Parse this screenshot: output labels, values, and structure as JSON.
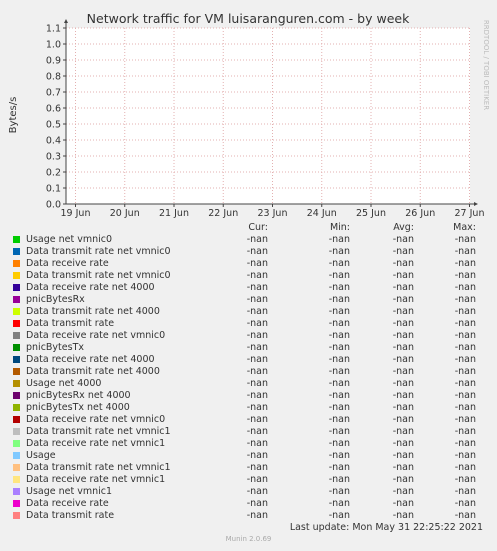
{
  "chart_data": {
    "type": "line",
    "title": "Network traffic for VM luisaranguren.com - by week",
    "ylabel": "Bytes/s",
    "xlabel": "",
    "ylim": [
      0.0,
      1.1
    ],
    "yticks": [
      "0.0",
      "0.1",
      "0.2",
      "0.3",
      "0.4",
      "0.5",
      "0.6",
      "0.7",
      "0.8",
      "0.9",
      "1.0",
      "1.1"
    ],
    "xticks": [
      "19 Jun",
      "20 Jun",
      "21 Jun",
      "22 Jun",
      "23 Jun",
      "24 Jun",
      "25 Jun",
      "26 Jun",
      "27 Jun"
    ],
    "grid": true,
    "watermark": "RRDTOOL / TOBI OETIKER",
    "series": []
  },
  "legend": {
    "headers": [
      "Cur:",
      "Min:",
      "Avg:",
      "Max:"
    ],
    "rows": [
      {
        "name": "Usage net vmnic0",
        "color": "#00cc00",
        "cur": "-nan",
        "min": "-nan",
        "avg": "-nan",
        "max": "-nan"
      },
      {
        "name": "Data transmit rate net vmnic0",
        "color": "#0066b3",
        "cur": "-nan",
        "min": "-nan",
        "avg": "-nan",
        "max": "-nan"
      },
      {
        "name": "Data receive rate",
        "color": "#ff8000",
        "cur": "-nan",
        "min": "-nan",
        "avg": "-nan",
        "max": "-nan"
      },
      {
        "name": "Data transmit rate net vmnic0",
        "color": "#ffcc00",
        "cur": "-nan",
        "min": "-nan",
        "avg": "-nan",
        "max": "-nan"
      },
      {
        "name": "Data receive rate net 4000",
        "color": "#330099",
        "cur": "-nan",
        "min": "-nan",
        "avg": "-nan",
        "max": "-nan"
      },
      {
        "name": "pnicBytesRx",
        "color": "#990099",
        "cur": "-nan",
        "min": "-nan",
        "avg": "-nan",
        "max": "-nan"
      },
      {
        "name": "Data transmit rate net 4000",
        "color": "#ccff00",
        "cur": "-nan",
        "min": "-nan",
        "avg": "-nan",
        "max": "-nan"
      },
      {
        "name": "Data transmit rate",
        "color": "#ff0000",
        "cur": "-nan",
        "min": "-nan",
        "avg": "-nan",
        "max": "-nan"
      },
      {
        "name": "Data receive rate net vmnic0",
        "color": "#808080",
        "cur": "-nan",
        "min": "-nan",
        "avg": "-nan",
        "max": "-nan"
      },
      {
        "name": "pnicBytesTx",
        "color": "#008f00",
        "cur": "-nan",
        "min": "-nan",
        "avg": "-nan",
        "max": "-nan"
      },
      {
        "name": "Data receive rate net 4000",
        "color": "#00487d",
        "cur": "-nan",
        "min": "-nan",
        "avg": "-nan",
        "max": "-nan"
      },
      {
        "name": "Data transmit rate net 4000",
        "color": "#b35a00",
        "cur": "-nan",
        "min": "-nan",
        "avg": "-nan",
        "max": "-nan"
      },
      {
        "name": "Usage net 4000",
        "color": "#b38f00",
        "cur": "-nan",
        "min": "-nan",
        "avg": "-nan",
        "max": "-nan"
      },
      {
        "name": "pnicBytesRx net 4000",
        "color": "#6b006b",
        "cur": "-nan",
        "min": "-nan",
        "avg": "-nan",
        "max": "-nan"
      },
      {
        "name": "pnicBytesTx net 4000",
        "color": "#8fb300",
        "cur": "-nan",
        "min": "-nan",
        "avg": "-nan",
        "max": "-nan"
      },
      {
        "name": "Data receive rate net vmnic0",
        "color": "#b30000",
        "cur": "-nan",
        "min": "-nan",
        "avg": "-nan",
        "max": "-nan"
      },
      {
        "name": "Data transmit rate net vmnic1",
        "color": "#bebebe",
        "cur": "-nan",
        "min": "-nan",
        "avg": "-nan",
        "max": "-nan"
      },
      {
        "name": "Data receive rate net vmnic1",
        "color": "#80ff80",
        "cur": "-nan",
        "min": "-nan",
        "avg": "-nan",
        "max": "-nan"
      },
      {
        "name": "Usage",
        "color": "#80c9ff",
        "cur": "-nan",
        "min": "-nan",
        "avg": "-nan",
        "max": "-nan"
      },
      {
        "name": "Data transmit rate net vmnic1",
        "color": "#ffc080",
        "cur": "-nan",
        "min": "-nan",
        "avg": "-nan",
        "max": "-nan"
      },
      {
        "name": "Data receive rate net vmnic1",
        "color": "#ffe680",
        "cur": "-nan",
        "min": "-nan",
        "avg": "-nan",
        "max": "-nan"
      },
      {
        "name": "Usage net vmnic1",
        "color": "#aa80ff",
        "cur": "-nan",
        "min": "-nan",
        "avg": "-nan",
        "max": "-nan"
      },
      {
        "name": "Data receive rate",
        "color": "#ee00cc",
        "cur": "-nan",
        "min": "-nan",
        "avg": "-nan",
        "max": "-nan"
      },
      {
        "name": "Data transmit rate",
        "color": "#ff8080",
        "cur": "-nan",
        "min": "-nan",
        "avg": "-nan",
        "max": "-nan"
      }
    ]
  },
  "footer": {
    "last_update": "Last update: Mon May 31 22:25:22 2021",
    "version": "Munin 2.0.69"
  }
}
